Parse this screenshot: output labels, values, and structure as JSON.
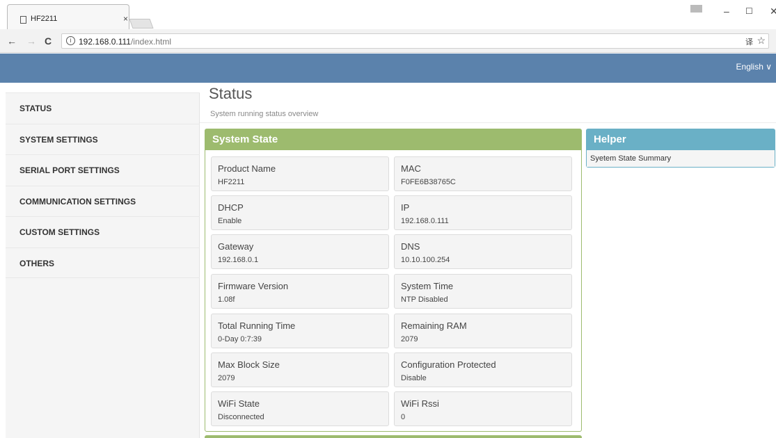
{
  "browser": {
    "tab_title": "HF2211",
    "tab_close": "×",
    "url_host": "192.168.0.111",
    "url_path": "/index.html",
    "nav_back": "←",
    "nav_forward": "→",
    "nav_reload": "C",
    "info_glyph": "i",
    "translate_glyph": "译",
    "star_glyph": "☆",
    "minimize_glyph": "–",
    "maximize_glyph": "☐",
    "close_glyph": "✕"
  },
  "header": {
    "language": "English ∨"
  },
  "sidebar": {
    "items": [
      {
        "label": "STATUS"
      },
      {
        "label": "SYSTEM SETTINGS"
      },
      {
        "label": "SERIAL PORT SETTINGS"
      },
      {
        "label": "COMMUNICATION SETTINGS"
      },
      {
        "label": "CUSTOM SETTINGS"
      },
      {
        "label": "OTHERS"
      }
    ]
  },
  "page": {
    "title": "Status",
    "subtitle": "System running status overview"
  },
  "system_state": {
    "title": "System State",
    "fields": [
      {
        "label": "Product Name",
        "value": "HF2211"
      },
      {
        "label": "MAC",
        "value": "F0FE6B38765C"
      },
      {
        "label": "DHCP",
        "value": "Enable"
      },
      {
        "label": "IP",
        "value": "192.168.0.111"
      },
      {
        "label": "Gateway",
        "value": "192.168.0.1"
      },
      {
        "label": "DNS",
        "value": "10.10.100.254"
      },
      {
        "label": "Firmware Version",
        "value": "1.08f"
      },
      {
        "label": "System Time",
        "value": "NTP Disabled"
      },
      {
        "label": "Total Running Time",
        "value": "0-Day 0:7:39"
      },
      {
        "label": "Remaining RAM",
        "value": "2079"
      },
      {
        "label": "Max Block Size",
        "value": "2079"
      },
      {
        "label": "Configuration Protected",
        "value": "Disable"
      },
      {
        "label": "WiFi State",
        "value": "Disconnected"
      },
      {
        "label": "WiFi Rssi",
        "value": "0"
      }
    ]
  },
  "helper": {
    "title": "Helper",
    "text": "Syetem State Summary"
  },
  "colors": {
    "topbar": "#5b82ac",
    "panel": "#9dbb6e",
    "helper": "#6ab0c6"
  }
}
